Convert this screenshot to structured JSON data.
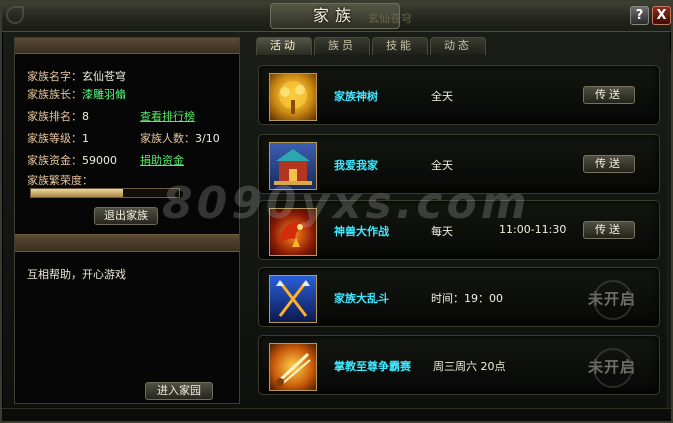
{
  "window": {
    "title": "家族",
    "title_overlay": "玄仙苍穹",
    "help_label": "?",
    "close_label": "X"
  },
  "family": {
    "name_label": "家族名字：",
    "name_value": "玄仙苍穹",
    "leader_label": "家族族长：",
    "leader_value": "漆雕羽翛",
    "rank_label": "家族排名：",
    "rank_value": "8",
    "view_rank_link": "查看排行榜",
    "level_label": "家族等级：",
    "level_value": "1",
    "members_label": "家族人数：",
    "members_value": "3/10",
    "funds_label": "家族资金：",
    "funds_value": "59000",
    "donate_link": "捐助资金",
    "prosperity_label": "家族繁荣度：",
    "prosperity_fraction": 0.62,
    "leave_button": "退出家族",
    "motto": "互相帮助，开心游戏",
    "enter_garden_button": "进入家园"
  },
  "tabs": [
    {
      "label": "活动"
    },
    {
      "label": "族员"
    },
    {
      "label": "技能"
    },
    {
      "label": "动态"
    }
  ],
  "activities": [
    {
      "name": "家族神树",
      "freq": "全天",
      "time": "",
      "action": "传送",
      "locked": false,
      "icon": "golden-tree-icon"
    },
    {
      "name": "我爱我家",
      "freq": "全天",
      "time": "",
      "action": "传送",
      "locked": false,
      "icon": "family-house-icon"
    },
    {
      "name": "神兽大作战",
      "freq": "每天",
      "time": "11:00-11:30",
      "action": "传送",
      "locked": false,
      "icon": "fire-dragon-icon"
    },
    {
      "name": "家族大乱斗",
      "freq": "时间：19：00",
      "time": "",
      "action": "未开启",
      "locked": true,
      "icon": "crossed-spears-icon"
    },
    {
      "name": "掌教至尊争霸赛",
      "freq": "周三周六 20点",
      "time": "",
      "action": "未开启",
      "locked": true,
      "icon": "flaming-swords-icon"
    }
  ],
  "watermark": "8090yxs.com",
  "colors": {
    "activity_name": "#3fe7ff",
    "link_green": "#58e86c",
    "label_gold": "#e7c59e"
  }
}
